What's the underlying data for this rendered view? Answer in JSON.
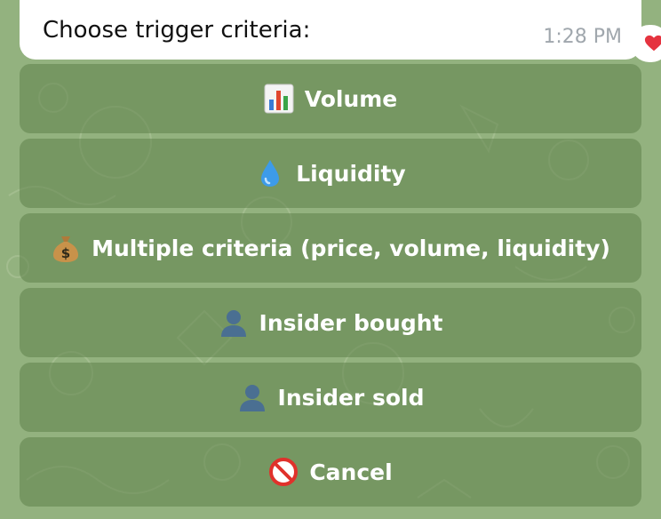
{
  "message": {
    "text": "Choose trigger criteria:",
    "time": "1:28 PM",
    "reaction_icon": "heart-icon",
    "reaction_color": "#e5333f"
  },
  "keyboard": {
    "buttons": [
      {
        "label": "Volume",
        "icon": "bar-chart-icon"
      },
      {
        "label": "Liquidity",
        "icon": "droplet-icon"
      },
      {
        "label": "Multiple criteria (price, volume, liquidity)",
        "icon": "money-bag-icon"
      },
      {
        "label": "Insider bought",
        "icon": "person-silhouette-icon"
      },
      {
        "label": "Insider sold",
        "icon": "person-silhouette-icon"
      },
      {
        "label": "Cancel",
        "icon": "prohibited-icon"
      }
    ]
  },
  "colors": {
    "background": "#93b27f",
    "button_fill": "#7a9a66",
    "button_text": "#ffffff",
    "bubble": "#ffffff",
    "time_text": "#a0a7ad"
  }
}
